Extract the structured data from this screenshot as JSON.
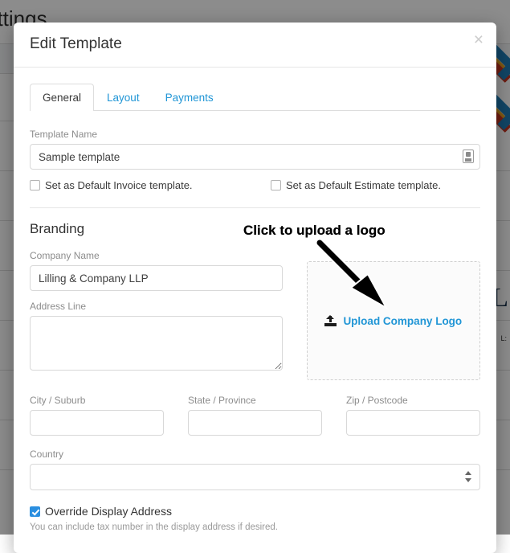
{
  "background": {
    "page_title": "ettings",
    "logo_letter": "L",
    "small_text": "L:"
  },
  "modal": {
    "title": "Edit Template",
    "close_label": "×",
    "tabs": [
      {
        "label": "General",
        "active": true
      },
      {
        "label": "Layout",
        "active": false
      },
      {
        "label": "Payments",
        "active": false
      }
    ],
    "template_name": {
      "label": "Template Name",
      "value": "Sample template",
      "placeholder": ""
    },
    "checkboxes": [
      {
        "label": "Set as Default Invoice template.",
        "checked": false
      },
      {
        "label": "Set as Default Estimate template.",
        "checked": false
      }
    ],
    "branding": {
      "section_title": "Branding",
      "company_name": {
        "label": "Company Name",
        "value": "Lilling & Company LLP",
        "placeholder": ""
      },
      "address_line": {
        "label": "Address Line",
        "value": "",
        "placeholder": ""
      },
      "dropzone": {
        "link_label": "Upload Company Logo",
        "icon": "upload-icon"
      },
      "city": {
        "label": "City / Suburb",
        "value": "",
        "placeholder": ""
      },
      "state": {
        "label": "State / Province",
        "value": "",
        "placeholder": ""
      },
      "zip": {
        "label": "Zip / Postcode",
        "value": "",
        "placeholder": ""
      },
      "country": {
        "label": "Country",
        "selected": "",
        "options": [
          ""
        ]
      },
      "override_display_address": {
        "label": "Override Display Address",
        "checked": true,
        "helper": "You can include tax number in the display address if desired."
      }
    }
  },
  "annotation": {
    "text": "Click to upload a logo"
  },
  "colors": {
    "link": "#2196d6",
    "accent_checkbox": "#2b8fe0",
    "overlay": "rgba(0,0,0,0.45)"
  }
}
